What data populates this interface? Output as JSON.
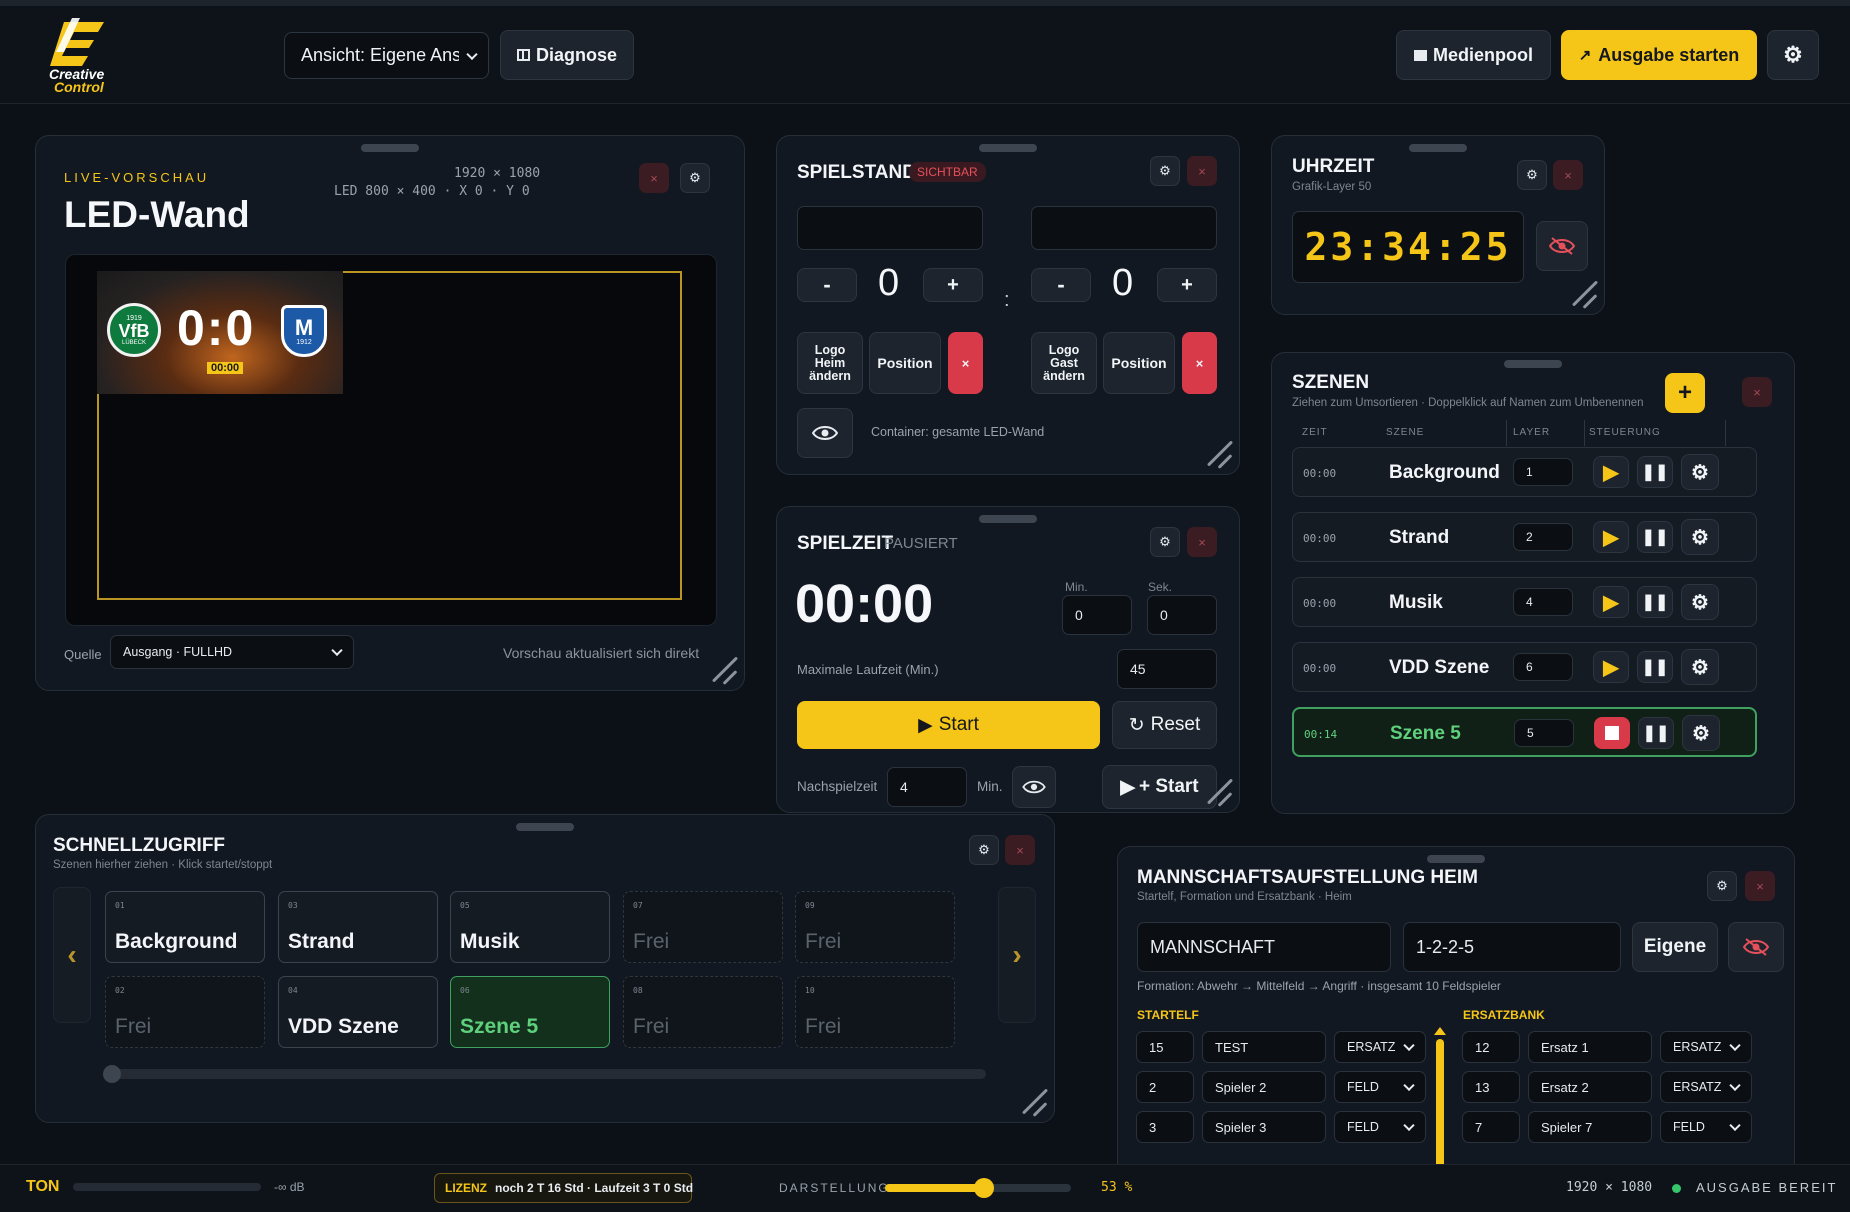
{
  "brand": {
    "logo_top": "Creative",
    "logo_bottom": "Control",
    "accent": "#f5c518"
  },
  "header": {
    "view_select": "Ansicht: Eigene Ansicht",
    "diagnose_label": "Diagnose",
    "medienpool_label": "Medienpool",
    "ausgabe_label": "Ausgabe starten"
  },
  "preview": {
    "kicker": "LIVE-VORSCHAU",
    "title": "LED-Wand",
    "resolution": "1920 × 1080",
    "led_info": "LED 800 × 400 · X 0 · Y 0",
    "score_overlay": "0:0",
    "overlay_time": "00:00",
    "home_crest": "VfB",
    "home_crest_year": "1919",
    "home_crest_city": "LÜBECK",
    "away_crest_year": "1912",
    "source_label": "Quelle",
    "source_value": "Ausgang · FULLHD",
    "hint": "Vorschau aktualisiert sich direkt"
  },
  "spielstand": {
    "title": "SPIELSTAND",
    "badge": "SICHTBAR",
    "home_score": "0",
    "away_score": "0",
    "separator": ":",
    "minus": "-",
    "plus": "+",
    "home_logo_btn": "Logo Heim ändern",
    "away_logo_btn": "Logo Gast ändern",
    "position_btn": "Position",
    "container_text": "Container: gesamte LED-Wand"
  },
  "uhrzeit": {
    "title": "UHRZEIT",
    "subtitle": "Grafik-Layer 50",
    "time": "23:34:25"
  },
  "spielzeit": {
    "title": "SPIELZEIT",
    "status": "PAUSIERT",
    "time": "00:00",
    "min_label": "Min.",
    "sek_label": "Sek.",
    "min_value": "0",
    "sek_value": "0",
    "max_label": "Maximale Laufzeit (Min.)",
    "max_value": "45",
    "start_label": "Start",
    "reset_label": "Reset",
    "nach_label": "Nachspielzeit",
    "nach_value": "4",
    "nach_unit": "Min.",
    "plus_start_label": "+ Start"
  },
  "szenen": {
    "title": "SZENEN",
    "subtitle": "Ziehen zum Umsortieren · Doppelklick auf Namen zum Umbenennen",
    "add": "+",
    "columns": [
      "ZEIT",
      "SZENE",
      "LAYER",
      "STEUERUNG"
    ],
    "rows": [
      {
        "time": "00:00",
        "name": "Background",
        "layer": "1"
      },
      {
        "time": "00:00",
        "name": "Strand",
        "layer": "2"
      },
      {
        "time": "00:00",
        "name": "Musik",
        "layer": "4"
      },
      {
        "time": "00:00",
        "name": "VDD Szene",
        "layer": "6"
      },
      {
        "time": "00:14",
        "name": "Szene 5",
        "layer": "5"
      }
    ]
  },
  "schnell": {
    "title": "SCHNELLZUGRIFF",
    "subtitle": "Szenen hierher ziehen · Klick startet/stoppt",
    "prev": "‹",
    "next": "›",
    "cells": [
      {
        "num": "01",
        "label": "Background"
      },
      {
        "num": "02",
        "label": "Frei"
      },
      {
        "num": "03",
        "label": "Strand"
      },
      {
        "num": "04",
        "label": "VDD Szene"
      },
      {
        "num": "05",
        "label": "Musik"
      },
      {
        "num": "06",
        "label": "Szene 5"
      },
      {
        "num": "07",
        "label": "Frei"
      },
      {
        "num": "08",
        "label": "Frei"
      },
      {
        "num": "09",
        "label": "Frei"
      },
      {
        "num": "10",
        "label": "Frei"
      }
    ]
  },
  "mannschaft": {
    "title": "MANNSCHAFTSAUFSTELLUNG HEIM",
    "subtitle": "Startelf, Formation und Ersatzbank · Heim",
    "team_name": "MANNSCHAFT",
    "formation": "1-2-2-5",
    "eigene_label": "Eigene",
    "formation_text": "Formation: Abwehr → Mittelfeld → Angriff · insgesamt 10 Feldspieler",
    "startelf_label": "STARTELF",
    "ersatz_label": "ERSATZBANK",
    "startelf": [
      {
        "num": "15",
        "name": "TEST",
        "role": "ERSATZ"
      },
      {
        "num": "2",
        "name": "Spieler 2",
        "role": "FELD"
      },
      {
        "num": "3",
        "name": "Spieler 3",
        "role": "FELD"
      }
    ],
    "ersatz": [
      {
        "num": "12",
        "name": "Ersatz 1",
        "role": "ERSATZ"
      },
      {
        "num": "13",
        "name": "Ersatz 2",
        "role": "ERSATZ"
      },
      {
        "num": "7",
        "name": "Spieler 7",
        "role": "FELD"
      }
    ]
  },
  "footer": {
    "ton_label": "TON",
    "db_value": "-∞ dB",
    "lizenz_label": "LIZENZ",
    "lizenz_text": "noch 2 T 16 Std · Laufzeit 3 T 0 Std",
    "darstellung_label": "DARSTELLUNG",
    "darstellung_value": "53 %",
    "darstellung_fraction": 0.53,
    "resolution": "1920 × 1080",
    "status": "AUSGABE BEREIT"
  }
}
